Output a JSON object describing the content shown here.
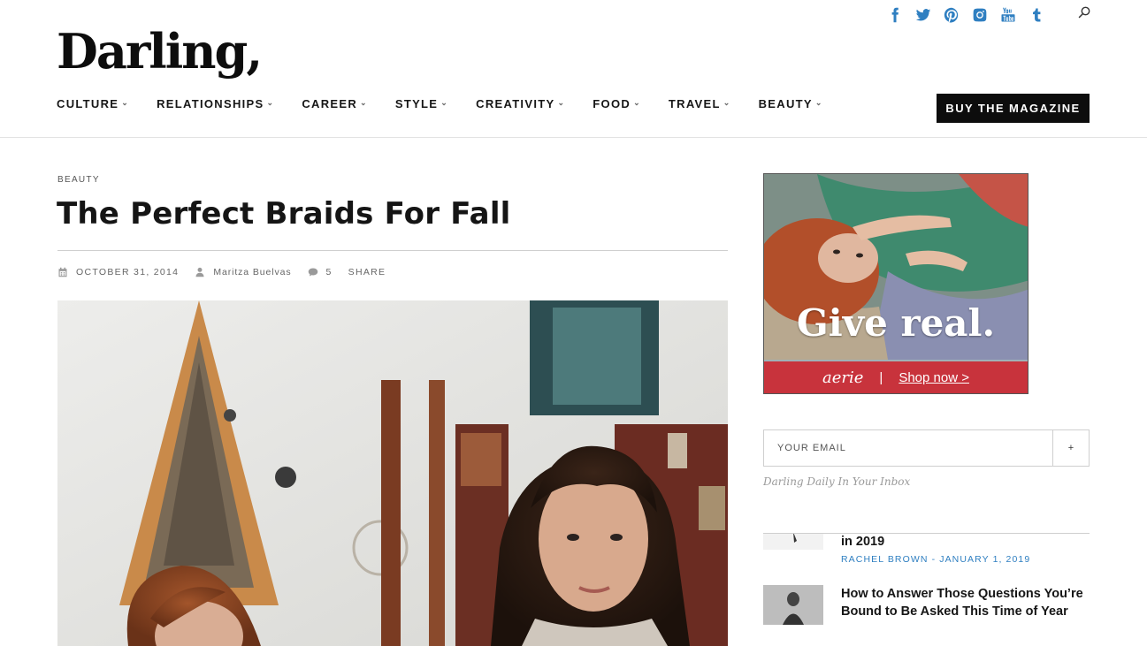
{
  "header": {
    "logo": "Darling,",
    "social": [
      "facebook-icon",
      "twitter-icon",
      "pinterest-icon",
      "instagram-icon",
      "youtube-icon",
      "tumblr-icon"
    ],
    "search_icon": "search-icon",
    "buy_label": "BUY THE MAGAZINE",
    "accent_color": "#2f7fc1"
  },
  "nav": {
    "items": [
      {
        "label": "CULTURE"
      },
      {
        "label": "RELATIONSHIPS"
      },
      {
        "label": "CAREER"
      },
      {
        "label": "STYLE"
      },
      {
        "label": "CREATIVITY"
      },
      {
        "label": "FOOD"
      },
      {
        "label": "TRAVEL"
      },
      {
        "label": "BEAUTY"
      }
    ]
  },
  "article": {
    "category": "BEAUTY",
    "title": "The Perfect Braids For Fall",
    "date": "OCTOBER 31, 2014",
    "author": "Maritza Buelvas",
    "comments": "5",
    "share": "SHARE"
  },
  "sidebar": {
    "ad": {
      "headline": "Give real.",
      "brand": "aerie",
      "separator": "|",
      "cta": "Shop now >",
      "color": "#c8333c"
    },
    "newsletter": {
      "placeholder": "YOUR EMAIL",
      "submit": "+",
      "tagline": "Darling Daily In Your Inbox"
    },
    "posts": [
      {
        "title": "in 2019",
        "author": "RACHEL BROWN",
        "date": "JANUARY 1, 2019"
      },
      {
        "title": "How to Answer Those Questions You’re Bound to Be Asked This Time of Year"
      }
    ]
  }
}
